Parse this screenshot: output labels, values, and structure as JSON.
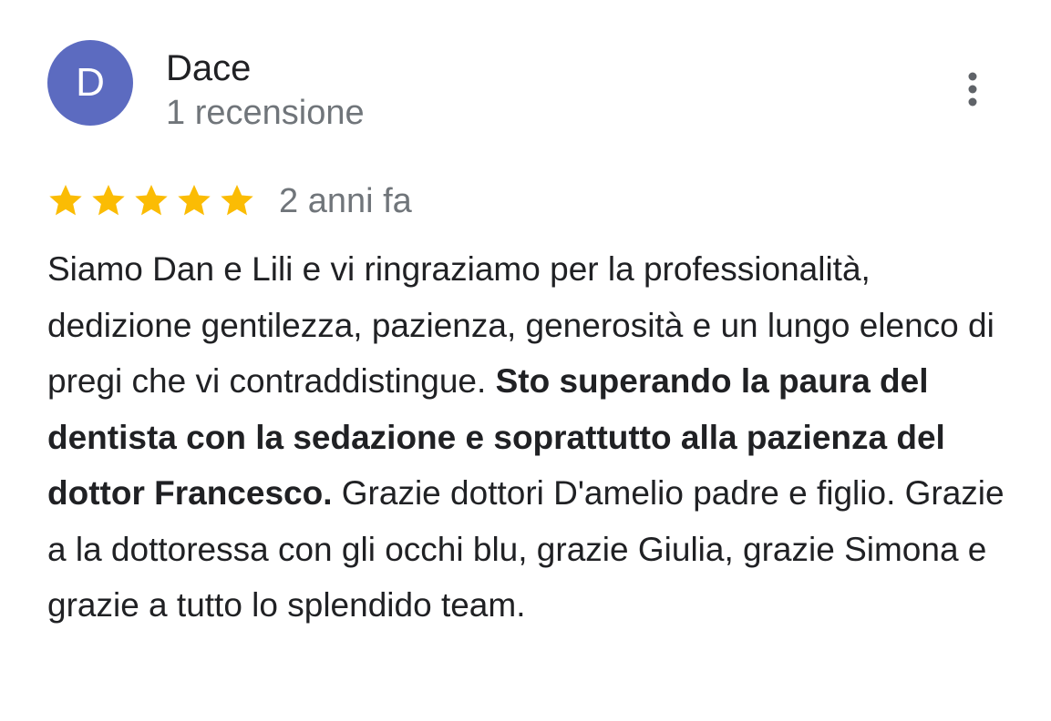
{
  "reviewer": {
    "initial": "D",
    "name": "Dace",
    "review_count": "1 recensione",
    "avatar_color": "#5c6bc0"
  },
  "menu": {
    "icon": "more-vertical-icon"
  },
  "rating": {
    "stars": 5,
    "max": 5,
    "star_color": "#fbbc04",
    "time": "2 anni fa"
  },
  "review": {
    "part1": "Siamo Dan e Lili e vi ringraziamo per la professionalità, dedizione gentilezza, pazienza, generosità e un lungo elenco di pregi che vi contraddistingue. ",
    "part2_bold": "Sto superando la paura del dentista con la sedazione e soprattutto alla pazienza del dottor Francesco.",
    "part3": " Grazie dottori D'amelio padre e figlio. Grazie a la dottoressa con gli occhi blu, grazie Giulia, grazie Simona e grazie a tutto lo splendido team."
  }
}
